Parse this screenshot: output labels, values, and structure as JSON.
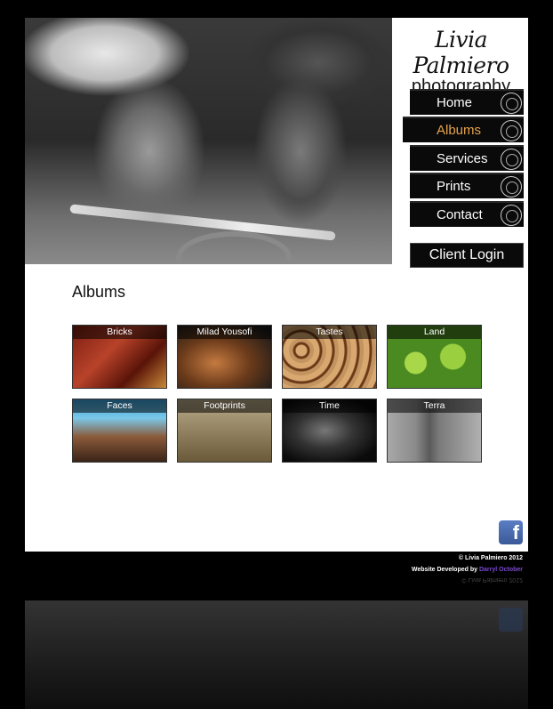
{
  "brand": {
    "name": "Livia Palmiero",
    "tagline": "photography"
  },
  "nav": {
    "items": [
      {
        "label": "Home",
        "active": false
      },
      {
        "label": "Albums",
        "active": true
      },
      {
        "label": "Services",
        "active": false
      },
      {
        "label": "Prints",
        "active": false
      },
      {
        "label": "Contact",
        "active": false
      }
    ],
    "client_login": "Client Login"
  },
  "main": {
    "title": "Albums",
    "albums": [
      {
        "label": "Bricks"
      },
      {
        "label": "Milad Yousofi"
      },
      {
        "label": "Tastes"
      },
      {
        "label": "Land"
      },
      {
        "label": "Faces"
      },
      {
        "label": "Footprints"
      },
      {
        "label": "Time"
      },
      {
        "label": "Terra"
      }
    ]
  },
  "social": {
    "facebook_icon": "facebook-icon",
    "facebook_glyph": "f"
  },
  "footer": {
    "copyright": "© Livia Palmiero 2012",
    "developed_prefix": "Website Developed by",
    "developer": "Darryl October"
  },
  "colors": {
    "accent": "#e8a44a",
    "developer_link": "#7a4acc",
    "facebook": "#3b5998"
  }
}
